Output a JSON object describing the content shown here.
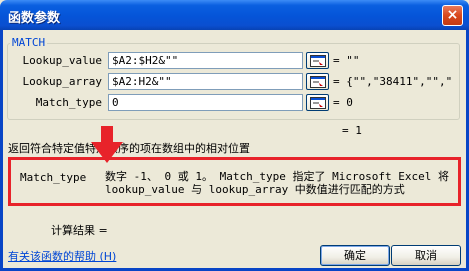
{
  "window": {
    "title": "函数参数",
    "close_glyph": "×"
  },
  "group": {
    "name": "MATCH"
  },
  "args": [
    {
      "label": "Lookup_value",
      "value": "$A2:$H2&\"\"",
      "result": "= \"\""
    },
    {
      "label": "Lookup_array",
      "value": "$A2:H2&\"\"",
      "result": "= {\"\",\"38411\",\"\",\""
    },
    {
      "label": "Match_type",
      "value": "0",
      "result": "= 0"
    }
  ],
  "formula_result": "= 1",
  "function_description": "返回符合特定值特定顺序的项在数组中的相对位置",
  "param_help": {
    "name": "Match_type",
    "line1": "数字 -1、 0 或 1。 Match_type 指定了 Microsoft Excel 将",
    "line2": "lookup_value 与 lookup_array 中数值进行匹配的方式"
  },
  "calc_result_label": "计算结果 =",
  "help_link": "有关该函数的帮助 (H)",
  "buttons": {
    "ok": "确定",
    "cancel": "取消"
  },
  "colors": {
    "highlight": "#e8232a",
    "titlebar": "#0554d8",
    "link": "#0046d5"
  },
  "icons": {
    "ref_button": "collapse-dialog-icon",
    "annotation": "red-down-arrow"
  }
}
